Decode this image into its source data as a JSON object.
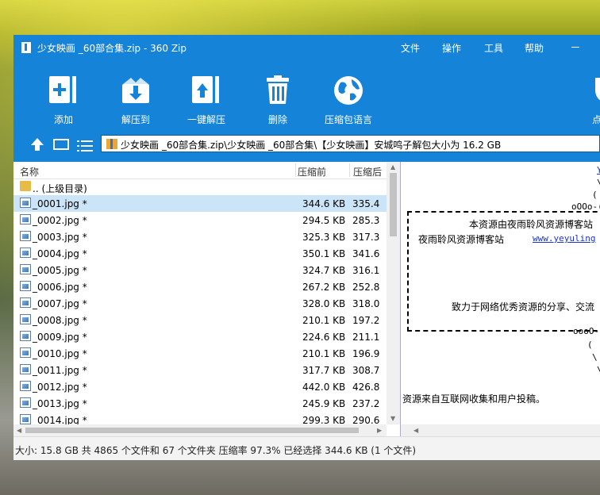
{
  "window": {
    "title": "少女映画 _60部合集.zip - 360 Zip",
    "menu": [
      "文件",
      "操作",
      "工具",
      "帮助"
    ]
  },
  "toolbar": {
    "buttons": [
      {
        "label": "添加",
        "icon": "add-icon"
      },
      {
        "label": "解压到",
        "icon": "extract-to-icon"
      },
      {
        "label": "一键解压",
        "icon": "one-click-extract-icon"
      },
      {
        "label": "删除",
        "icon": "delete-icon"
      },
      {
        "label": "压缩包语言",
        "icon": "language-globe-icon"
      },
      {
        "label": "点",
        "icon": "shield-icon"
      }
    ]
  },
  "address": {
    "path": "少女映画 _60部合集.zip\\少女映画 _60部合集\\【少女映画】安城鸣子解包大小为 16.2 GB"
  },
  "list": {
    "headers": {
      "name": "名称",
      "compressed": "压缩前",
      "after": "压缩后"
    },
    "parent": ".. (上级目录)",
    "rows": [
      {
        "name": "_0001.jpg *",
        "size": "344.6 KB",
        "packed": "335.4"
      },
      {
        "name": "_0002.jpg *",
        "size": "294.5 KB",
        "packed": "285.3"
      },
      {
        "name": "_0003.jpg *",
        "size": "325.3 KB",
        "packed": "317.3"
      },
      {
        "name": "_0004.jpg *",
        "size": "350.1 KB",
        "packed": "341.6"
      },
      {
        "name": "_0005.jpg *",
        "size": "324.7 KB",
        "packed": "316.1"
      },
      {
        "name": "_0006.jpg *",
        "size": "267.2 KB",
        "packed": "252.8"
      },
      {
        "name": "_0007.jpg *",
        "size": "328.0 KB",
        "packed": "318.0"
      },
      {
        "name": "_0008.jpg *",
        "size": "210.1 KB",
        "packed": "197.2"
      },
      {
        "name": "_0009.jpg *",
        "size": "224.6 KB",
        "packed": "211.1"
      },
      {
        "name": "_0010.jpg *",
        "size": "210.1 KB",
        "packed": "196.9"
      },
      {
        "name": "_0011.jpg *",
        "size": "317.7 KB",
        "packed": "308.7"
      },
      {
        "name": "_0012.jpg *",
        "size": "442.0 KB",
        "packed": "426.8"
      },
      {
        "name": "_0013.jpg *",
        "size": "245.9 KB",
        "packed": "237.2"
      },
      {
        "name": "_0014.jpg *",
        "size": "299.3 KB",
        "packed": "290.6"
      }
    ],
    "selected_index": 0
  },
  "comment": {
    "l1": "Y",
    "l2": "\\\\",
    "l3": "(",
    "l4": "oOOo-(",
    "notice": "本资源由夜雨聆风资源博客站",
    "site_name": "夜雨聆风资源博客站",
    "site_url": "www.yeyuling",
    "slogan": "致力于网络优秀资源的分享、交流",
    "l5": "oooO-",
    "l6": "(",
    "l7": "\\",
    "l8": "\\",
    "source": "资源来自互联网收集和用户投稿。"
  },
  "status": {
    "text": "大小: 15.8 GB 共 4865 个文件和 67 个文件夹 压缩率 97.3% 已经选择 344.6 KB (1 个文件)"
  }
}
